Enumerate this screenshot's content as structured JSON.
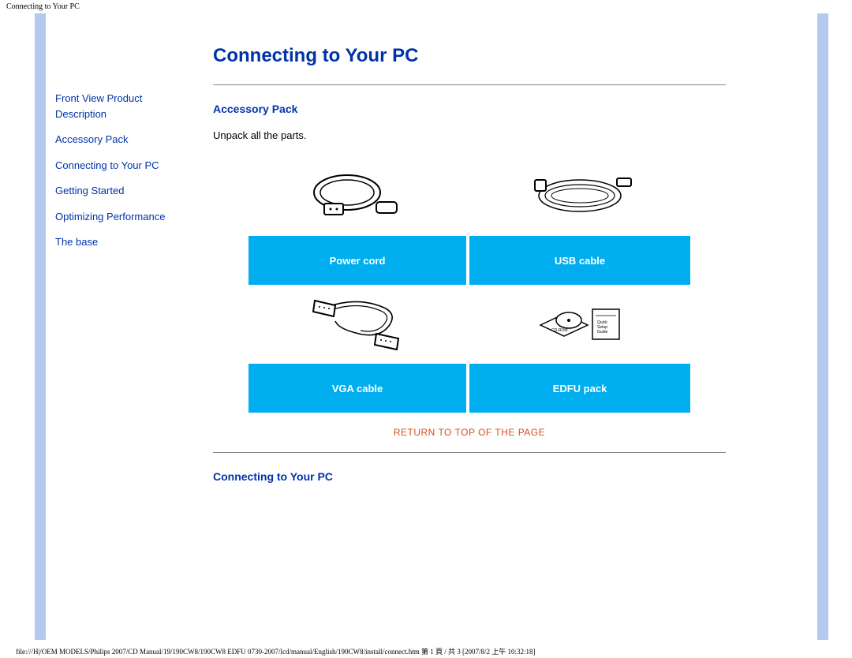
{
  "header": {
    "title": "Connecting to Your PC"
  },
  "page": {
    "title": "Connecting to Your PC"
  },
  "sidebar": {
    "links": [
      {
        "label": "Front View Product Description"
      },
      {
        "label": "Accessory Pack"
      },
      {
        "label": "Connecting to Your PC"
      },
      {
        "label": "Getting Started"
      },
      {
        "label": "Optimizing Performance"
      },
      {
        "label": "The base"
      }
    ]
  },
  "section1": {
    "heading": "Accessory Pack",
    "intro": "Unpack all the parts.",
    "items": [
      {
        "label": "Power cord"
      },
      {
        "label": "USB cable"
      },
      {
        "label": "VGA cable"
      },
      {
        "label": "EDFU pack"
      }
    ],
    "return_link": "RETURN TO TOP OF THE PAGE"
  },
  "section2": {
    "heading": "Connecting to Your PC"
  },
  "footer": {
    "path": "file:///H|/OEM MODELS/Philips 2007/CD Manual/19/190CW8/190CW8 EDFU 0730-2007/lcd/manual/English/190CW8/install/connect.htm 第 1 頁 / 共 3  [2007/8/2 上午 10:32:18]"
  }
}
